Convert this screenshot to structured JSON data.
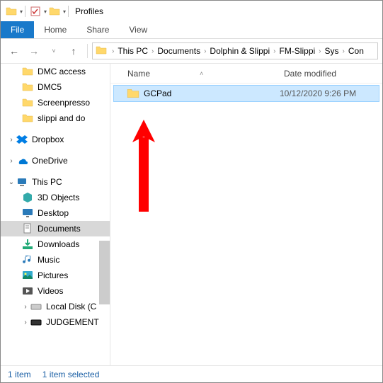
{
  "window": {
    "title": "Profiles"
  },
  "ribbon": {
    "file": "File",
    "tabs": [
      "Home",
      "Share",
      "View"
    ]
  },
  "breadcrumbs": [
    "This PC",
    "Documents",
    "Dolphin & Slippi",
    "FM-Slippi",
    "Sys",
    "Con"
  ],
  "columns": {
    "name": "Name",
    "date": "Date modified"
  },
  "quick_access": [
    {
      "label": "DMC access",
      "icon": "folder"
    },
    {
      "label": "DMC5",
      "icon": "folder"
    },
    {
      "label": "Screenpresso",
      "icon": "folder"
    },
    {
      "label": "slippi and do",
      "icon": "folder"
    }
  ],
  "cloud": [
    {
      "label": "Dropbox",
      "icon": "dropbox"
    },
    {
      "label": "OneDrive",
      "icon": "onedrive"
    }
  ],
  "thispc": {
    "label": "This PC",
    "children": [
      {
        "label": "3D Objects",
        "icon": "3d"
      },
      {
        "label": "Desktop",
        "icon": "desktop"
      },
      {
        "label": "Documents",
        "icon": "documents",
        "selected": true
      },
      {
        "label": "Downloads",
        "icon": "downloads"
      },
      {
        "label": "Music",
        "icon": "music"
      },
      {
        "label": "Pictures",
        "icon": "pictures"
      },
      {
        "label": "Videos",
        "icon": "videos"
      },
      {
        "label": "Local Disk (C",
        "icon": "disk"
      },
      {
        "label": "JUDGEMENT",
        "icon": "drive"
      }
    ]
  },
  "files": [
    {
      "name": "GCPad",
      "date": "10/12/2020 9:26 PM",
      "selected": true
    }
  ],
  "status": {
    "count": "1 item",
    "selected": "1 item selected"
  }
}
